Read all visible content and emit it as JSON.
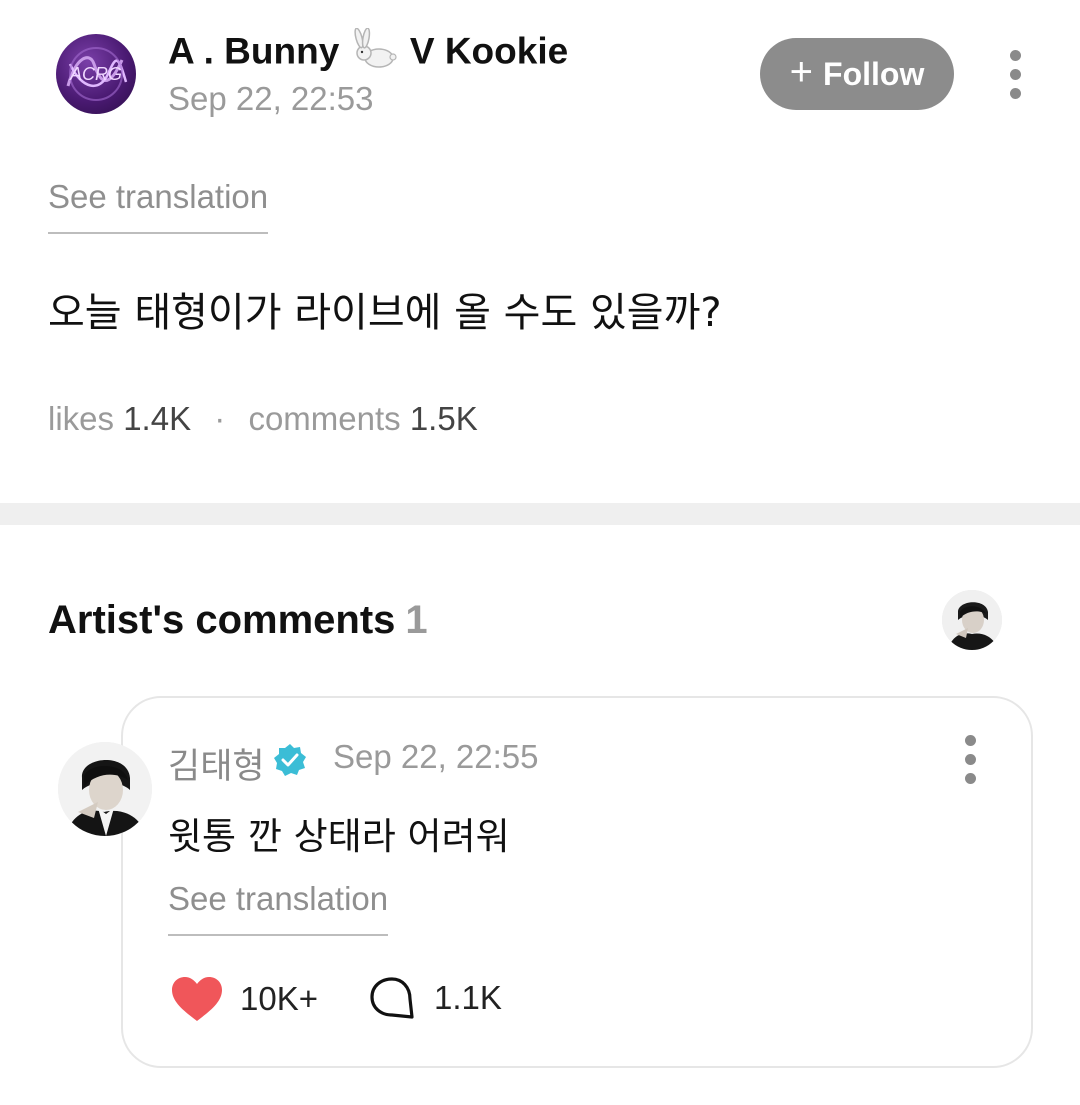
{
  "post": {
    "author": {
      "name_prefix": "A . Bunny",
      "name_suffix": "V Kookie",
      "emoji_icon": "rabbit-icon",
      "avatar_logo_text": "ACRG"
    },
    "timestamp": "Sep 22, 22:53",
    "follow_label": "Follow",
    "see_translation": "See translation",
    "body": "오늘 태형이가 라이브에 올 수도 있을까?",
    "stats": {
      "likes_label": "likes",
      "likes_value": "1.4K",
      "comments_label": "comments",
      "comments_value": "1.5K",
      "separator": "·"
    }
  },
  "artist_comments": {
    "title": "Artist's comments",
    "count": "1",
    "comments": [
      {
        "author": "김태형",
        "verified": true,
        "timestamp": "Sep 22, 22:55",
        "text": "윗통 깐 상태라 어려워",
        "see_translation": "See translation",
        "likes": "10K+",
        "replies": "1.1K"
      }
    ]
  },
  "colors": {
    "follow_bg": "#8c8c8c",
    "heart": "#f0565a",
    "verified": "#3bbdd6",
    "muted_text": "#9a9a9a",
    "divider": "#efefef"
  }
}
